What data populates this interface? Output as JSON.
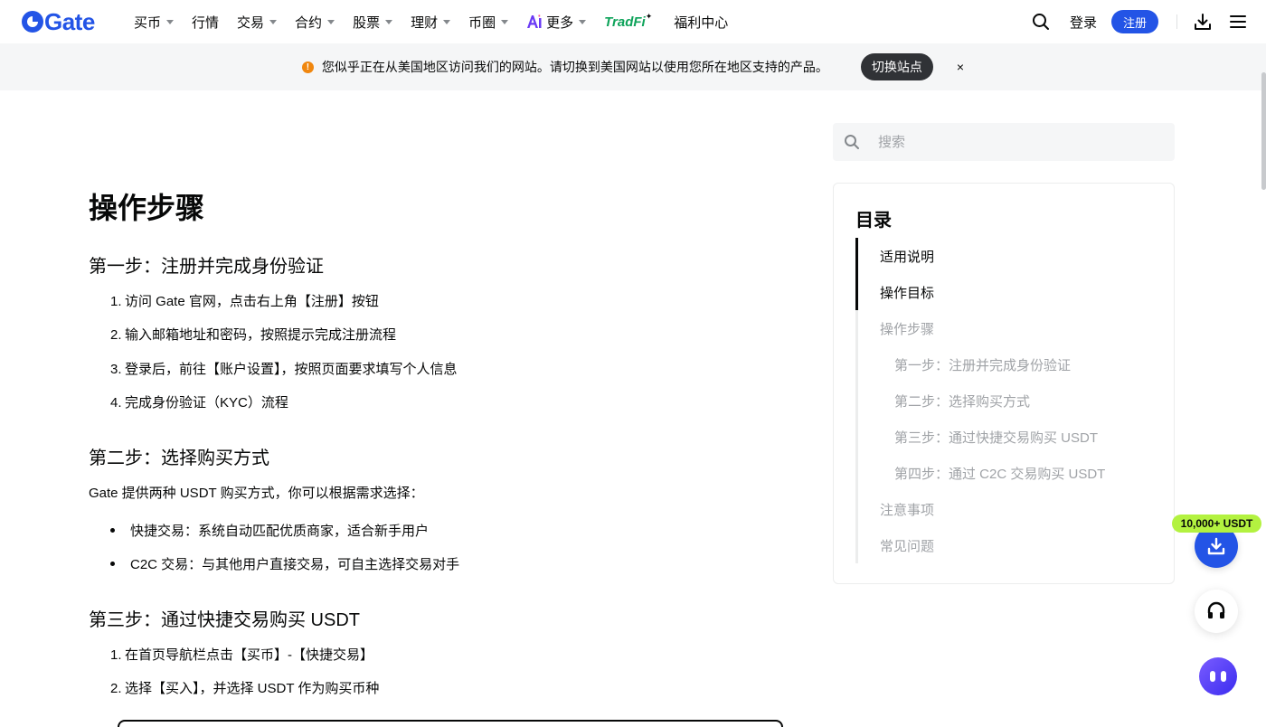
{
  "brand": {
    "name": "Gate",
    "color": "#2354e6"
  },
  "nav": {
    "items": [
      {
        "label": "买币",
        "has_dropdown": true
      },
      {
        "label": "行情",
        "has_dropdown": false
      },
      {
        "label": "交易",
        "has_dropdown": true
      },
      {
        "label": "合约",
        "has_dropdown": true
      },
      {
        "label": "股票",
        "has_dropdown": true
      },
      {
        "label": "理财",
        "has_dropdown": true
      },
      {
        "label": "币圈",
        "has_dropdown": true
      },
      {
        "label": "更多",
        "has_dropdown": true,
        "icon": "ai-icon"
      }
    ],
    "tradfi_label": "TradFi",
    "welfare_label": "福利中心",
    "login_label": "登录",
    "register_label": "注册"
  },
  "banner": {
    "message": "您似乎正在从美国地区访问我们的网站。请切换到美国网站以使用您所在地区支持的产品。",
    "switch_label": "切换站点",
    "close_label": "×"
  },
  "article": {
    "heading": "操作步骤",
    "step1": {
      "title": "第一步：注册并完成身份验证",
      "items": [
        "访问 Gate 官网，点击右上角【注册】按钮",
        "输入邮箱地址和密码，按照提示完成注册流程",
        "登录后，前往【账户设置】，按照页面要求填写个人信息",
        "完成身份验证（KYC）流程"
      ]
    },
    "step2": {
      "title": "第二步：选择购买方式",
      "intro": "Gate 提供两种 USDT 购买方式，你可以根据需求选择：",
      "bullets": [
        "快捷交易：系统自动匹配优质商家，适合新手用户",
        "C2C 交易：与其他用户直接交易，可自主选择交易对手"
      ]
    },
    "step3": {
      "title": "第三步：通过快捷交易购买 USDT",
      "items": [
        "在首页导航栏点击【买币】-【快捷交易】",
        "选择【买入】，并选择 USDT 作为购买币种"
      ]
    }
  },
  "sidebar": {
    "search_placeholder": "搜索",
    "toc_title": "目录",
    "toc": [
      {
        "label": "适用说明",
        "level": 1,
        "state": "read"
      },
      {
        "label": "操作目标",
        "level": 1,
        "state": "read"
      },
      {
        "label": "操作步骤",
        "level": 1,
        "state": "unread"
      },
      {
        "label": "第一步：注册并完成身份验证",
        "level": 2,
        "state": "unread"
      },
      {
        "label": "第二步：选择购买方式",
        "level": 2,
        "state": "unread"
      },
      {
        "label": "第三步：通过快捷交易购买 USDT",
        "level": 2,
        "state": "unread"
      },
      {
        "label": "第四步：通过 C2C 交易购买 USDT",
        "level": 2,
        "state": "unread"
      },
      {
        "label": "注意事项",
        "level": 1,
        "state": "unread"
      },
      {
        "label": "常见问题",
        "level": 1,
        "state": "unread"
      }
    ]
  },
  "floating": {
    "badge_label": "10,000+ USDT",
    "badge_color": "#b3f240"
  }
}
